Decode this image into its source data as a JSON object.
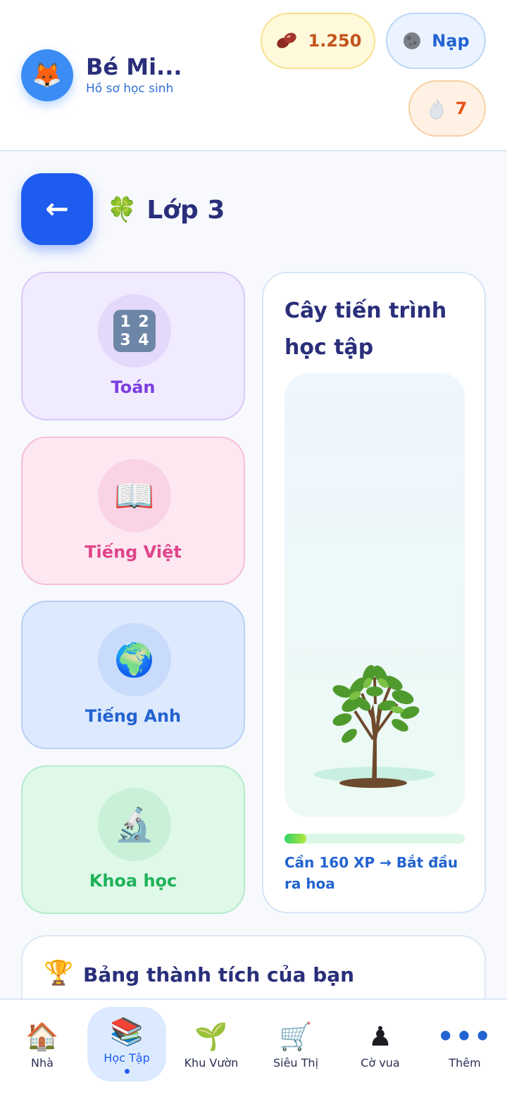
{
  "header": {
    "avatar_emoji": "🦊",
    "profile_name": "Bé Mi...",
    "profile_subtitle": "Hồ sơ học sinh",
    "beans": {
      "icon": "bean-icon",
      "value": "1.250"
    },
    "topup": {
      "icon": "moon-coin-icon",
      "label": "Nạp"
    },
    "streak": {
      "icon": "flame-icon",
      "value": "7"
    }
  },
  "grade": {
    "back_label": "←",
    "clover": "🍀",
    "title": "Lớp 3"
  },
  "subjects": [
    {
      "key": "math",
      "label": "Toán",
      "icon": "numbers-icon",
      "glyph": "1234"
    },
    {
      "key": "viet",
      "label": "Tiếng Việt",
      "icon": "open-book-icon",
      "glyph": "📖"
    },
    {
      "key": "eng",
      "label": "Tiếng Anh",
      "icon": "globe-icon",
      "glyph": "🌍"
    },
    {
      "key": "sci",
      "label": "Khoa học",
      "icon": "microscope-icon",
      "glyph": "🔬"
    }
  ],
  "tree_card": {
    "title": "Cây tiến trình học tập",
    "progress_fraction": 0.12,
    "caption": "Cần 160 XP → Bắt đầu ra hoa"
  },
  "achievements": {
    "icon": "trophy-icon",
    "trophy": "🏆",
    "title": "Bảng thành tích của bạn"
  },
  "bottom_nav": {
    "items": [
      {
        "label": "Nhà",
        "icon": "house-icon",
        "glyph": "🏠",
        "active": false
      },
      {
        "label": "Học Tập",
        "icon": "books-icon",
        "glyph": "📚",
        "active": true
      },
      {
        "label": "Khu Vườn",
        "icon": "sprout-icon",
        "glyph": "🌱",
        "active": false
      },
      {
        "label": "Siêu Thị",
        "icon": "cart-icon",
        "glyph": "🛒",
        "active": false
      },
      {
        "label": "Cờ vua",
        "icon": "chess-pawn-icon",
        "glyph": "♟",
        "active": false
      },
      {
        "label": "Thêm",
        "icon": "more-dots-icon",
        "glyph": "•••",
        "active": false
      }
    ]
  },
  "colors": {
    "primary": "#1e5cf0",
    "heading": "#2a2f7a",
    "math": "#7b3fe0",
    "viet": "#e0458a",
    "eng": "#2363d1",
    "sci": "#1fb25a"
  }
}
